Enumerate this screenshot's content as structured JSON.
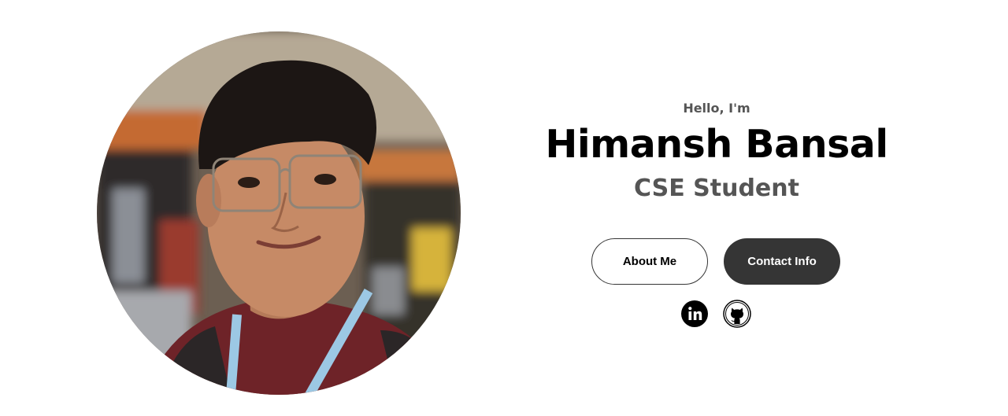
{
  "profile": {
    "greeting": "Hello, I'm",
    "name": "Himansh Bansal",
    "role": "CSE Student",
    "photo_alt": "Profile picture"
  },
  "buttons": {
    "about": "About Me",
    "contact": "Contact Info"
  },
  "socials": [
    {
      "icon": "linkedin-icon",
      "label": "LinkedIn"
    },
    {
      "icon": "github-icon",
      "label": "GitHub"
    }
  ],
  "colors": {
    "button_dark": "#353535",
    "text_gray": "#555555",
    "text_black": "#000000"
  }
}
